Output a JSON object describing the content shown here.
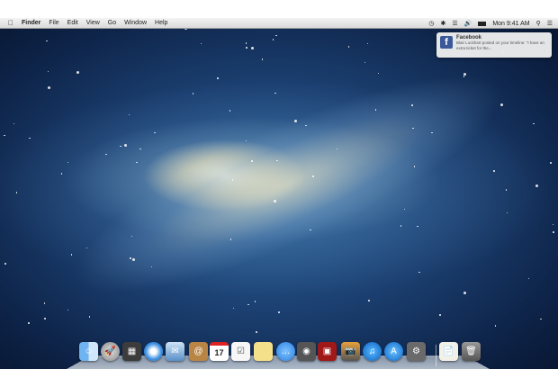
{
  "menubar": {
    "apple": "",
    "items": [
      "Finder",
      "File",
      "Edit",
      "View",
      "Go",
      "Window",
      "Help"
    ],
    "clock": "Mon 9:41 AM",
    "status_icons": [
      "time-machine-icon",
      "bluetooth-icon",
      "wifi-icon",
      "volume-icon",
      "battery-icon",
      "spotlight-icon",
      "notification-center-icon"
    ]
  },
  "notification": {
    "app": "Facebook",
    "icon": "f",
    "body": "Blair Lockhart posted on your timeline: \"I have an extra ticket for the..."
  },
  "dock": {
    "apps": [
      "Finder",
      "Launchpad",
      "Mission Control",
      "Safari",
      "Mail",
      "Contacts",
      "Calendar",
      "Reminders",
      "Notes",
      "Messages",
      "FaceTime",
      "Photo Booth",
      "iPhoto",
      "iTunes",
      "App Store",
      "System Preferences"
    ],
    "calendar_day": "17",
    "others": [
      "Documents",
      "Trash"
    ]
  }
}
